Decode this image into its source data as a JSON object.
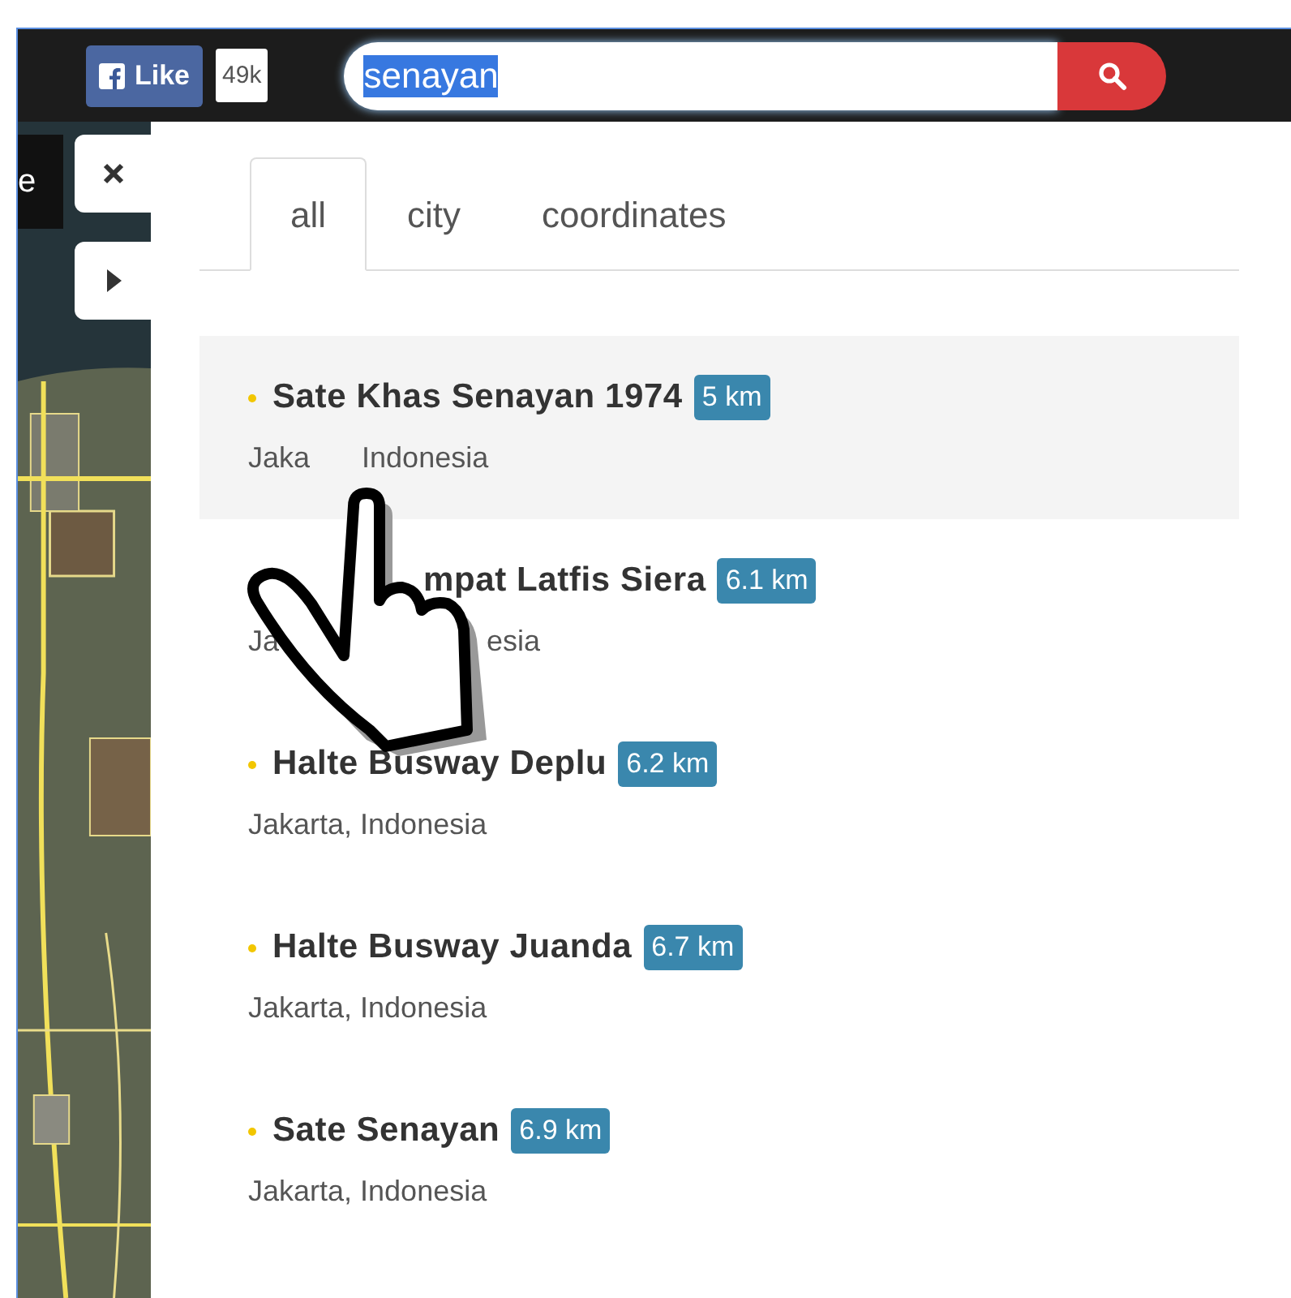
{
  "like_button": {
    "label": "Like",
    "count": "49k"
  },
  "search": {
    "value": "senayan",
    "value_selected": true
  },
  "side_panel": {
    "label": "e"
  },
  "tabs": [
    {
      "label": "all",
      "selected": true
    },
    {
      "label": "city",
      "selected": false
    },
    {
      "label": "coordinates",
      "selected": false
    }
  ],
  "results": [
    {
      "title_fragments": [
        "Sate Khas Senayan 1974"
      ],
      "distance": "5 km",
      "subtitle_fragments": [
        "Jaka",
        "Indonesia"
      ],
      "highlighted": true,
      "bullet": true
    },
    {
      "title_fragments": [
        "mpat Latfis Siera"
      ],
      "distance": "6.1 km",
      "subtitle_fragments": [
        "Ja",
        "esia"
      ],
      "highlighted": false,
      "bullet": false
    },
    {
      "title_fragments": [
        "Halte Busway Deplu"
      ],
      "distance": "6.2 km",
      "subtitle_fragments": [
        "Jakarta, Indonesia"
      ],
      "highlighted": false,
      "bullet": true
    },
    {
      "title_fragments": [
        "Halte Busway Juanda"
      ],
      "distance": "6.7 km",
      "subtitle_fragments": [
        "Jakarta, Indonesia"
      ],
      "highlighted": false,
      "bullet": true
    },
    {
      "title_fragments": [
        "Sate Senayan"
      ],
      "distance": "6.9 km",
      "subtitle_fragments": [
        "Jakarta, Indonesia"
      ],
      "highlighted": false,
      "bullet": true
    }
  ],
  "cursor": {
    "kind": "hand"
  }
}
